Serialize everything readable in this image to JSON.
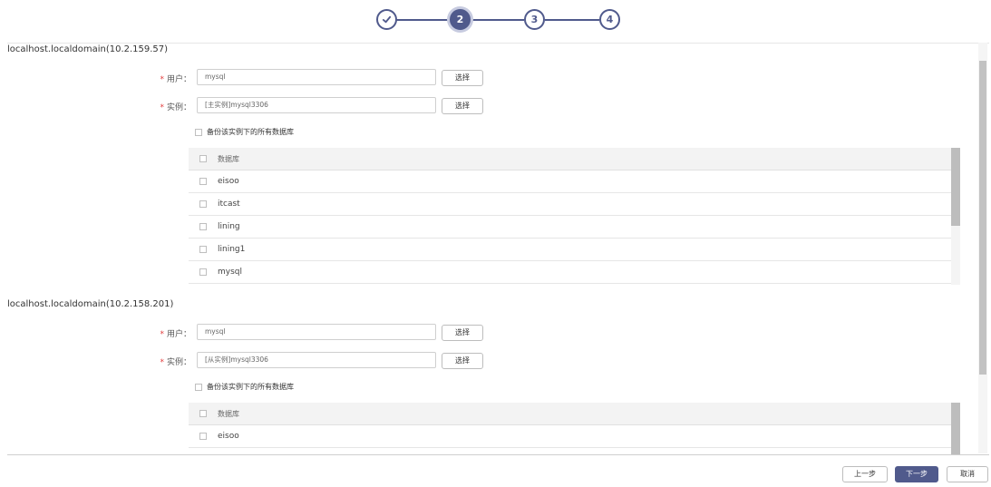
{
  "stepper": {
    "steps": [
      {
        "label": "",
        "state": "done"
      },
      {
        "label": "2",
        "state": "active"
      },
      {
        "label": "3",
        "state": "pending"
      },
      {
        "label": "4",
        "state": "pending"
      }
    ]
  },
  "hosts": [
    {
      "title": "localhost.localdomain(10.2.159.57)",
      "user_label": "用户：",
      "user_value": "mysql",
      "instance_label": "实例：",
      "instance_value": "[主实例]mysql3306",
      "select_label": "选择",
      "backup_all_label": "备份该实例下的所有数据库",
      "db_header": "数据库",
      "databases": [
        "eisoo",
        "itcast",
        "lining",
        "lining1",
        "mysql"
      ]
    },
    {
      "title": "localhost.localdomain(10.2.158.201)",
      "user_label": "用户：",
      "user_value": "mysql",
      "instance_label": "实例：",
      "instance_value": "[从实例]mysql3306",
      "select_label": "选择",
      "backup_all_label": "备份该实例下的所有数据库",
      "db_header": "数据库",
      "databases": [
        "eisoo"
      ]
    }
  ],
  "footer": {
    "prev_label": "上一步",
    "next_label": "下一步",
    "cancel_label": "取消"
  },
  "colors": {
    "accent": "#505a8c",
    "required": "#e23d3d"
  },
  "icons": {
    "done_step": "check-icon"
  }
}
